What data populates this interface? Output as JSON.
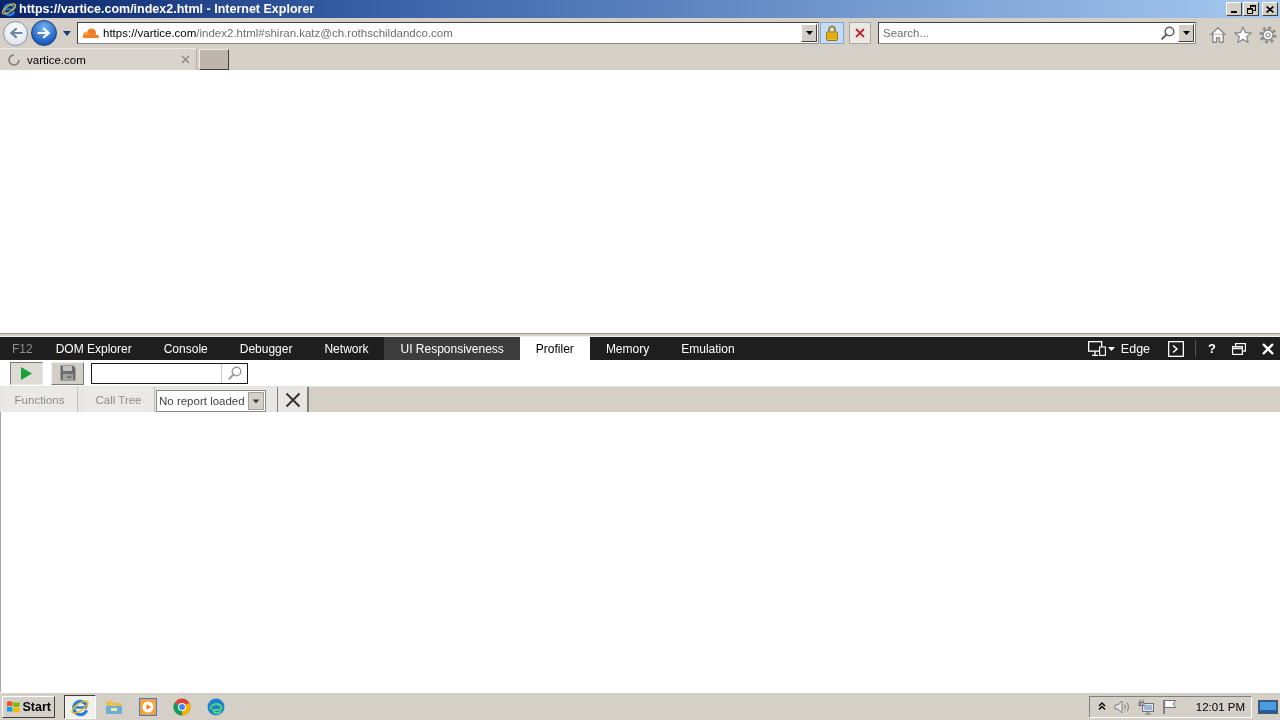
{
  "window": {
    "title": "https://vartice.com/index2.html - Internet Explorer"
  },
  "address_bar": {
    "url_host": "https://vartice.com",
    "url_path": "/index2.html#shiran.katz@ch.rothschildandco.com",
    "secure": true
  },
  "search": {
    "placeholder": "Search..."
  },
  "tabs": [
    {
      "label": "vartice.com",
      "selected": true,
      "loading": true
    }
  ],
  "devtools": {
    "label": "F12",
    "tabs": [
      {
        "label": "DOM Explorer",
        "selected": false,
        "highlighted": false
      },
      {
        "label": "Console",
        "selected": false,
        "highlighted": false
      },
      {
        "label": "Debugger",
        "selected": false,
        "highlighted": false
      },
      {
        "label": "Network",
        "selected": false,
        "highlighted": false
      },
      {
        "label": "UI Responsiveness",
        "selected": false,
        "highlighted": true
      },
      {
        "label": "Profiler",
        "selected": true,
        "highlighted": false
      },
      {
        "label": "Memory",
        "selected": false,
        "highlighted": false
      },
      {
        "label": "Emulation",
        "selected": false,
        "highlighted": false
      }
    ],
    "document_mode": "Edge",
    "help": "?"
  },
  "profiler": {
    "views": [
      {
        "label": "Functions",
        "disabled": true
      },
      {
        "label": "Call Tree",
        "disabled": true
      }
    ],
    "report": {
      "value": "No report loaded"
    }
  },
  "taskbar": {
    "start": "Start",
    "apps": [
      {
        "kind": "browser",
        "active": true
      },
      {
        "kind": "folder",
        "active": false
      },
      {
        "kind": "media",
        "active": false
      },
      {
        "kind": "chrome",
        "active": false
      },
      {
        "kind": "edge",
        "active": false
      }
    ],
    "clock": "12:01 PM"
  }
}
